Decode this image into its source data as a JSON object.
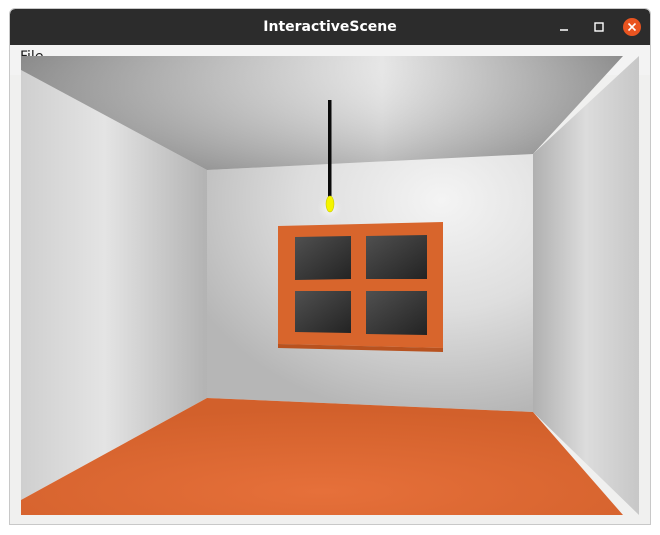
{
  "window": {
    "title": "InteractiveScene"
  },
  "menubar": {
    "items": [
      {
        "label": "File"
      }
    ]
  },
  "controls": {
    "minimize_icon": "minimize-icon",
    "maximize_icon": "maximize-icon",
    "close_icon": "close-icon"
  },
  "colors": {
    "titlebar": "#2c2c2c",
    "close_button": "#e95420",
    "floor": "#e06a32",
    "window_frame": "#d8652c",
    "glass": "#2f2f2f",
    "bulb": "#f5f500"
  }
}
